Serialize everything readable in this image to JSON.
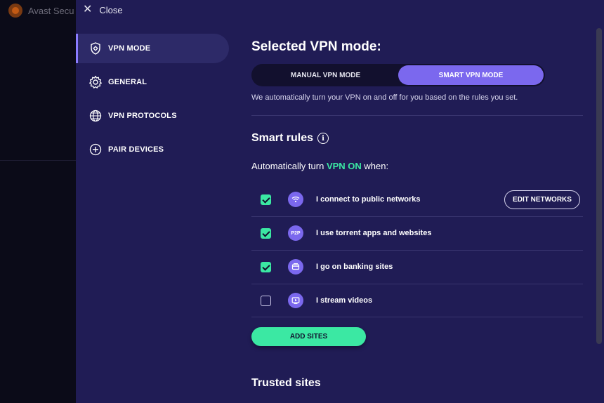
{
  "background_app": {
    "title": "Avast Secu"
  },
  "overlay": {
    "close_label": "Close"
  },
  "sidebar": {
    "items": [
      {
        "label": "VPN MODE",
        "icon": "shield-gear-icon",
        "active": true
      },
      {
        "label": "GENERAL",
        "icon": "gear-icon",
        "active": false
      },
      {
        "label": "VPN PROTOCOLS",
        "icon": "globe-icon",
        "active": false
      },
      {
        "label": "PAIR DEVICES",
        "icon": "plus-circle-icon",
        "active": false
      }
    ]
  },
  "main": {
    "selected_heading": "Selected VPN mode:",
    "mode_toggle": {
      "manual_label": "MANUAL VPN MODE",
      "smart_label": "SMART VPN MODE",
      "selected": "SMART VPN MODE"
    },
    "mode_description": "We automatically turn your VPN on and off for you based on the rules you set.",
    "smart_rules_heading": "Smart rules",
    "auto_turn": {
      "prefix": "Automatically turn",
      "highlight": "VPN ON",
      "suffix": "when:"
    },
    "rules": [
      {
        "label": "I connect to public networks",
        "checked": true,
        "icon": "wifi-icon",
        "button": "EDIT NETWORKS"
      },
      {
        "label": "I use torrent apps and websites",
        "checked": true,
        "icon": "p2p-icon",
        "icon_text": "P2P"
      },
      {
        "label": "I go on banking sites",
        "checked": true,
        "icon": "bank-card-icon"
      },
      {
        "label": "I stream videos",
        "checked": false,
        "icon": "video-play-icon"
      }
    ],
    "add_sites_label": "ADD SITES",
    "trusted_sites_heading": "Trusted sites"
  },
  "colors": {
    "accent": "#7b68ee",
    "green": "#3be8a3",
    "panel": "#201c55",
    "background": "#12112a"
  }
}
